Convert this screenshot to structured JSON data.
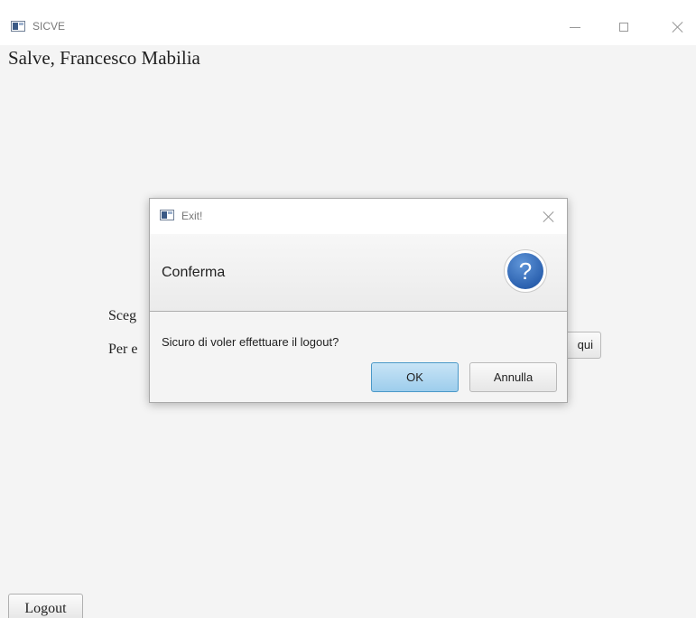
{
  "window": {
    "title": "SICVE"
  },
  "main": {
    "greeting": "Salve, Francesco Mabilia",
    "choose_fragment": "Sceg",
    "per_fragment": "Per e",
    "qui_button_label": "qui",
    "logout_label": "Logout"
  },
  "dialog": {
    "title": "Exit!",
    "header": "Conferma",
    "header_icon": "question-icon",
    "question_glyph": "?",
    "message": "Sicuro di voler effettuare il logout?",
    "ok_label": "OK",
    "cancel_label": "Annulla"
  },
  "colors": {
    "default_button": "#9dcdec",
    "question_icon": "#2c62b0",
    "background": "#f4f4f4"
  }
}
